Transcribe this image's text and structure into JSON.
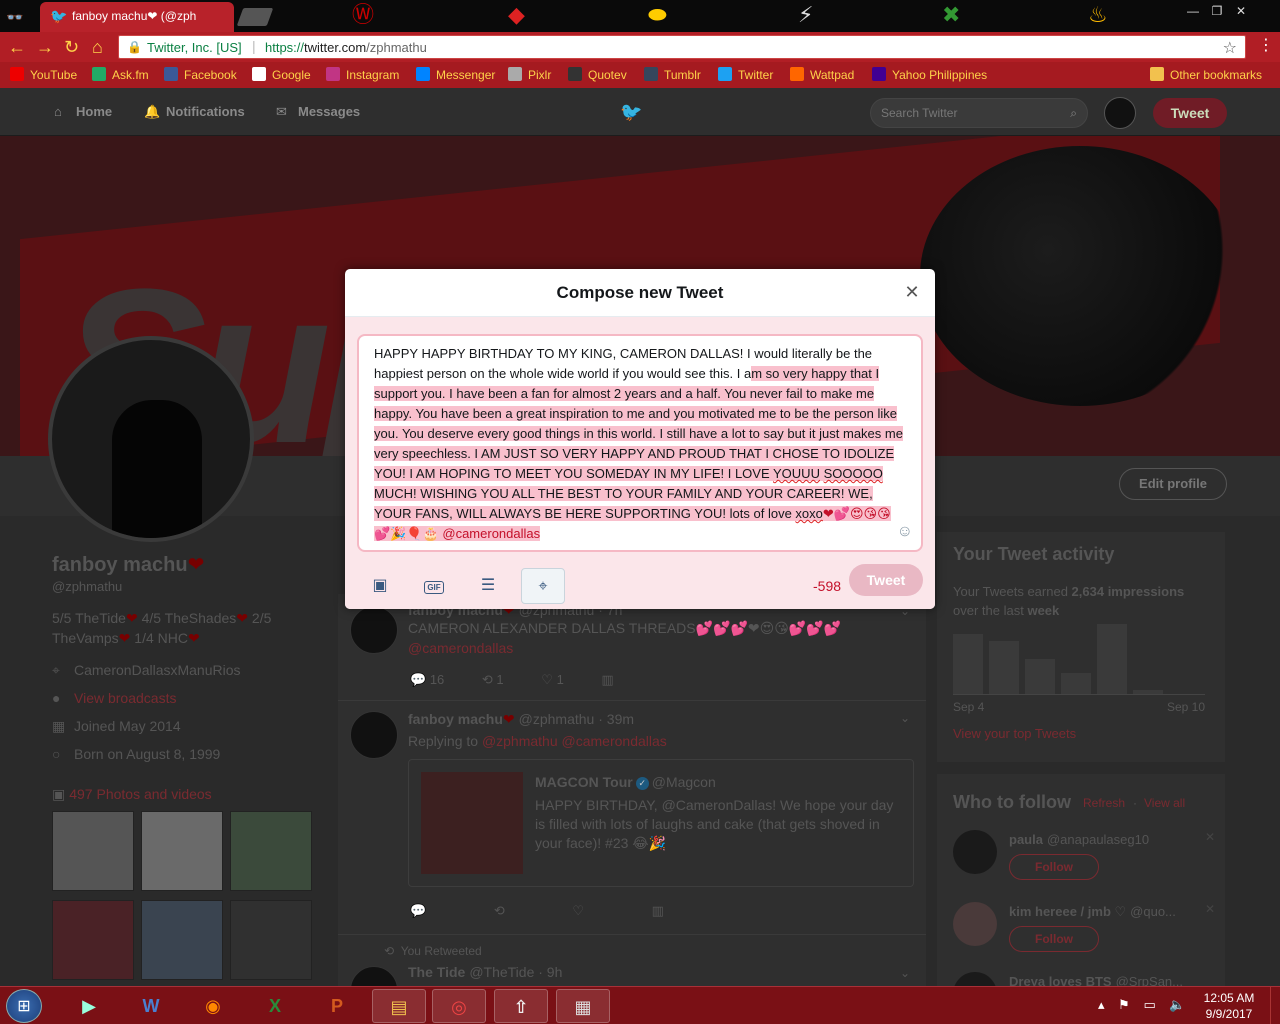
{
  "browser": {
    "tab_title": "fanboy machu❤ (@zph",
    "security_label": "Twitter, Inc. [US]",
    "url_scheme": "https://",
    "url_host": "twitter.com",
    "url_path": "/zphmathu",
    "bookmarks": [
      {
        "label": "YouTube",
        "color": "#e00"
      },
      {
        "label": "Ask.fm",
        "color": "#2a6"
      },
      {
        "label": "Facebook",
        "color": "#3b5998"
      },
      {
        "label": "Google",
        "color": "#fff"
      },
      {
        "label": "Instagram",
        "color": "#c13584"
      },
      {
        "label": "Messenger",
        "color": "#0084ff"
      },
      {
        "label": "Pixlr",
        "color": "#aaa"
      },
      {
        "label": "Quotev",
        "color": "#333"
      },
      {
        "label": "Tumblr",
        "color": "#35465c"
      },
      {
        "label": "Twitter",
        "color": "#1da1f2"
      },
      {
        "label": "Wattpad",
        "color": "#f60"
      },
      {
        "label": "Yahoo Philippines",
        "color": "#410093"
      }
    ],
    "other_bookmarks": "Other bookmarks"
  },
  "twitter_nav": {
    "home": "Home",
    "notifications": "Notifications",
    "messages": "Messages",
    "search_placeholder": "Search Twitter",
    "tweet_button": "Tweet"
  },
  "profile": {
    "edit_profile": "Edit profile",
    "name": "fanboy machu",
    "handle": "@zphmathu",
    "bio_parts": [
      "5/5 TheTide",
      "4/5 TheShades",
      "2/5",
      "TheVamps",
      "1/4 NHC"
    ],
    "location": "CameronDallasxManuRios",
    "broadcasts": "View broadcasts",
    "joined": "Joined May 2014",
    "born": "Born on August 8, 1999",
    "photos": "497 Photos and videos"
  },
  "feed": {
    "tweet1": {
      "name": "fanboy machu",
      "handle": "@zphmathu · 7h",
      "text": "CAMERON ALEXANDER DALLAS THREADS💕💕💕❤😍😘💕💕💕",
      "mention": "@camerondallas",
      "replies": "16",
      "retweets": "1",
      "likes": "1"
    },
    "tweet2": {
      "name": "fanboy machu",
      "handle": "@zphmathu · 39m",
      "replying_prefix": "Replying to",
      "replying_to": "@zphmathu @camerondallas",
      "quote_name": "MAGCON Tour",
      "quote_handle": "@Magcon",
      "quote_text": "HAPPY BIRTHDAY, @CameronDallas! We hope your day is filled with lots of laughs and cake (that gets shoved in your face)! #23 😂🎉"
    },
    "retweeted_label": "You Retweeted",
    "tweet3": {
      "name": "The Tide",
      "handle": "@TheTide · 9h"
    }
  },
  "activity": {
    "title": "Your Tweet activity",
    "impressions_prefix": "Your Tweets earned",
    "impressions": "2,634 impressions",
    "period_prefix": "over the last",
    "period": "week",
    "bars": [
      0.85,
      0.75,
      0.5,
      0.3,
      1.0,
      0.05
    ],
    "axis_start": "Sep 4",
    "axis_end": "Sep 10",
    "link": "View your top Tweets"
  },
  "who_to_follow": {
    "title": "Who to follow",
    "refresh": "Refresh",
    "view_all": "View all",
    "follow_label": "Follow",
    "users": [
      {
        "name": "paula",
        "handle": "@anapaulaseg10"
      },
      {
        "name": "kim hereee / jmb ♡",
        "handle": "@quo..."
      },
      {
        "name": "Dreya loves BTS",
        "handle": "@SrpSan..."
      }
    ]
  },
  "compose": {
    "title": "Compose new Tweet",
    "text_plain": "HAPPY HAPPY BIRTHDAY TO MY KING, CAMERON DALLAS! I would literally be the happiest person on the whole wide world if you would see this. I a",
    "text_over_a": "m so very happy that I support you. I have been a fan for almost 2 years and a half. You never fail to make me happy. You have been a great inspiration to me and you motivated me to be the person like you. You deserve every good things in this world. I still have a lot to say but it just makes me very speechless. I AM JUST SO VERY HAPPY AND PROUD THAT I CHOSE TO IDOLIZE YOU! I AM HOPING TO MEET YOU SOMEDAY IN MY LIFE! I LOVE ",
    "text_sq1": "YOUUU",
    "text_mid": " ",
    "text_sq2": "SOOOOO",
    "text_over_b": " MUCH! WISHING YOU ALL THE BEST TO YOUR FAMILY AND YOUR CAREER! WE, YOUR FANS, WILL ALWAYS BE HERE SUPPORTING YOU! lots of love ",
    "text_sq3": "xoxo",
    "emoji_tail": "❤💕😍😘😘💕🎉🎈🎂",
    "text_mention": "@camerondallas",
    "counter": "-598",
    "tweet_button": "Tweet"
  },
  "taskbar": {
    "time": "12:05 AM",
    "date": "9/9/2017"
  }
}
